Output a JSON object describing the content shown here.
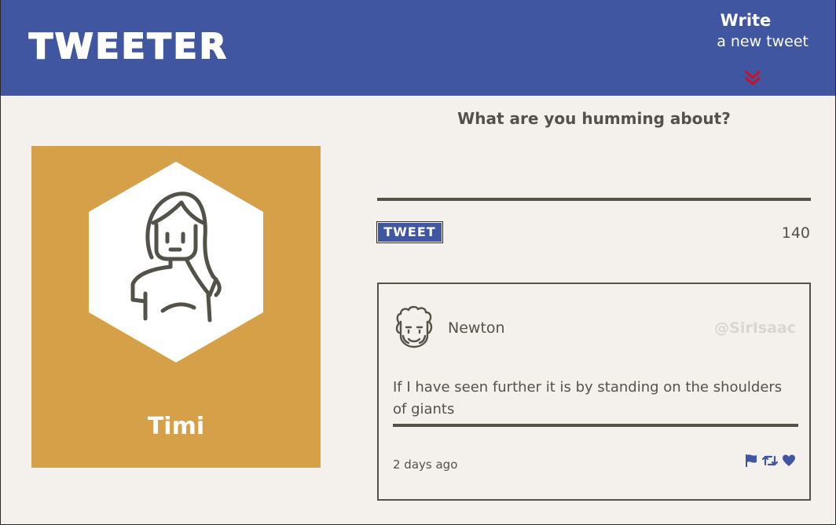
{
  "nav": {
    "brand": "TWEETER",
    "compose_toggle": {
      "line1": "Write",
      "line2": "a new tweet",
      "icon": "double-chevron-down-icon"
    }
  },
  "profile": {
    "name": "Timi",
    "avatar_icon": "user-avatar-icon"
  },
  "compose": {
    "heading": "What are you humming about?",
    "input_value": "",
    "submit_label": "TWEET",
    "counter": "140"
  },
  "tweets": [
    {
      "avatar_icon": "newton-avatar-icon",
      "author": "Newton",
      "handle": "@SirIsaac",
      "text": "If I have seen further it is by standing on the shoulders of giants",
      "time": "2 days ago",
      "actions": [
        "flag-icon",
        "retweet-icon",
        "heart-icon"
      ]
    }
  ],
  "colors": {
    "nav_bg": "#4056a1",
    "accent_red": "#c3142d",
    "profile_bg": "#d6a049",
    "page_bg": "#f4f1ec",
    "text": "#545149",
    "handle": "#d8d6d2"
  }
}
